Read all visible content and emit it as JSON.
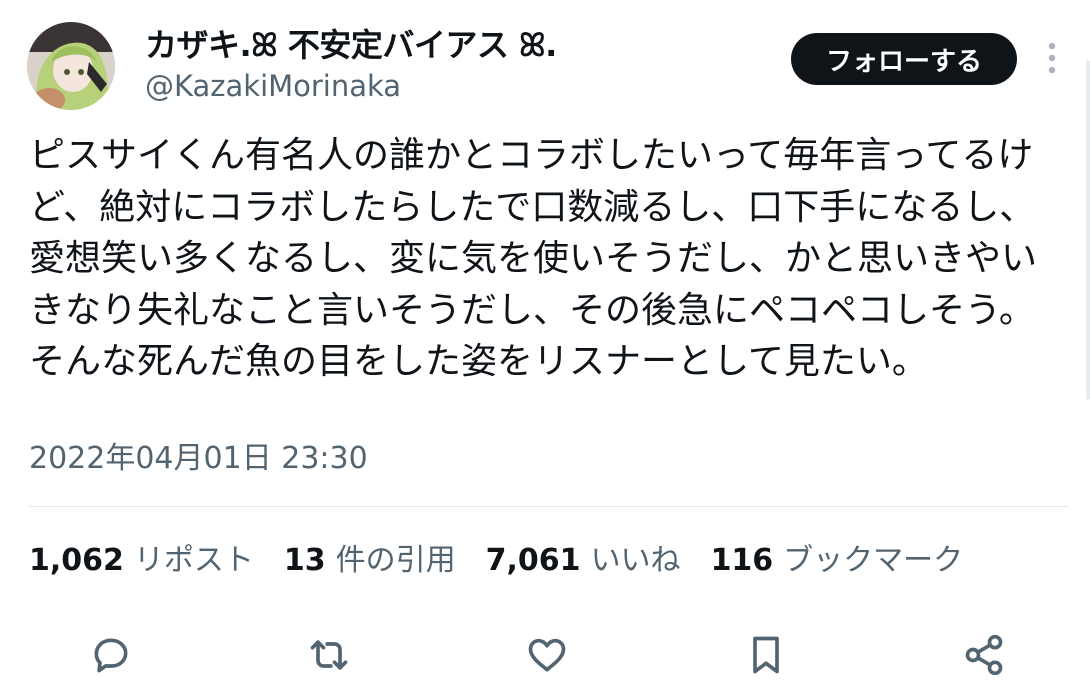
{
  "user": {
    "display_name": "カザキ.ꕤ 不安定バイアス ꕤ.",
    "handle": "@KazakiMorinaka",
    "avatar_icon": "anime-avatar-icon"
  },
  "header": {
    "follow_label": "フォローする",
    "more_icon": "more-vertical-icon"
  },
  "tweet": {
    "text": "ピスサイくん有名人の誰かとコラボしたいって毎年言ってるけど、絶対にコラボしたらしたで口数減るし、口下手になるし、愛想笑い多くなるし、変に気を使いそうだし、かと思いきやいきなり失礼なこと言いそうだし、その後急にペコペコしそう。\nそんな死んだ魚の目をした姿をリスナーとして見たい。",
    "timestamp": "2022年04月01日 23:30"
  },
  "stats": [
    {
      "count": "1,062",
      "label": "リポスト"
    },
    {
      "count": "13",
      "label": "件の引用"
    },
    {
      "count": "7,061",
      "label": "いいね"
    },
    {
      "count": "116",
      "label": "ブックマーク"
    }
  ],
  "actions": [
    "reply-icon",
    "repost-icon",
    "like-icon",
    "bookmark-icon",
    "share-icon"
  ],
  "colors": {
    "text_primary": "#0f1419",
    "text_secondary": "#536471",
    "button_bg": "#0f1419",
    "button_text": "#ffffff",
    "divider": "#e5e8eb"
  }
}
